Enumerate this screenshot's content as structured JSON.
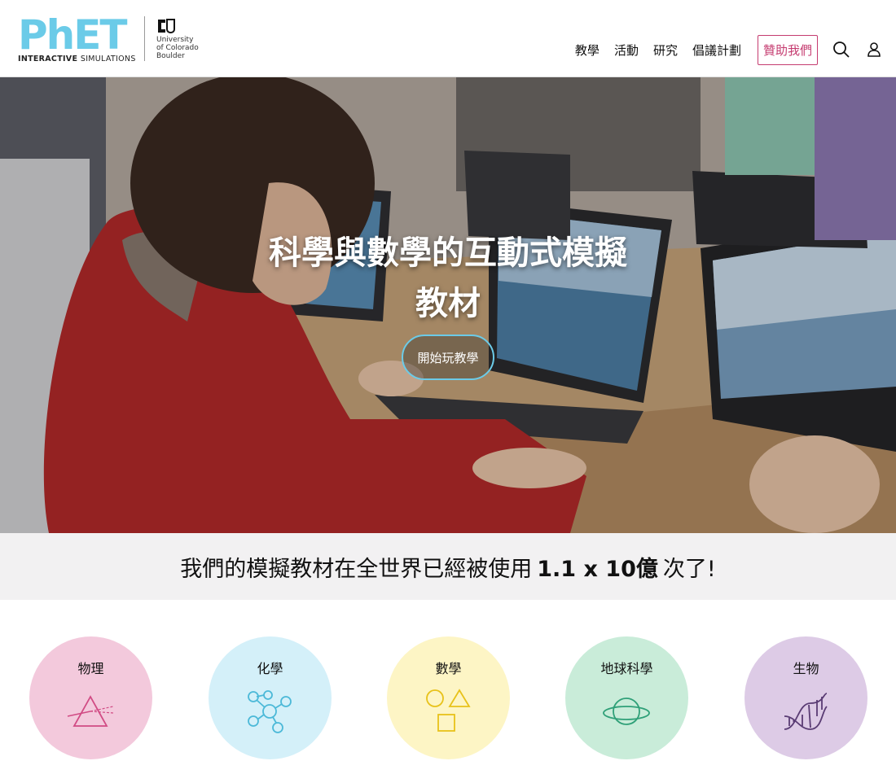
{
  "logo": {
    "brand": "PhET",
    "tagline_bold": "INTERACTIVE",
    "tagline_light": "SIMULATIONS",
    "university_line1": "University",
    "university_line2": "of Colorado",
    "university_line3": "Boulder"
  },
  "nav": {
    "items": [
      "教學",
      "活動",
      "研究",
      "倡議計劃"
    ],
    "donate": "贊助我們",
    "search_icon": "search-icon",
    "account_icon": "user-icon"
  },
  "hero": {
    "title_line1": "科學與數學的互動式模擬",
    "title_line2": "教材",
    "button": "開始玩教學"
  },
  "stats": {
    "prefix": "我們的模擬教材在全世界已經被使用",
    "number": "1.1 x 10億",
    "suffix": "次了!"
  },
  "subjects": [
    {
      "label": "物理",
      "color": "#f3c9dc",
      "icon": "prism-icon",
      "icon_color": "#d14b84"
    },
    {
      "label": "化學",
      "color": "#d4f0f9",
      "icon": "molecule-icon",
      "icon_color": "#4cb9d8"
    },
    {
      "label": "數學",
      "color": "#fdf5c5",
      "icon": "shapes-icon",
      "icon_color": "#e8c21a"
    },
    {
      "label": "地球科學",
      "color": "#c9ecd9",
      "icon": "planet-icon",
      "icon_color": "#2fa078"
    },
    {
      "label": "生物",
      "color": "#ddcbe6",
      "icon": "dna-icon",
      "icon_color": "#5a3c74"
    }
  ],
  "colors": {
    "accent_blue": "#6bcbe8",
    "donate_pink": "#c53c70",
    "stats_bg": "#f2f1f2"
  }
}
